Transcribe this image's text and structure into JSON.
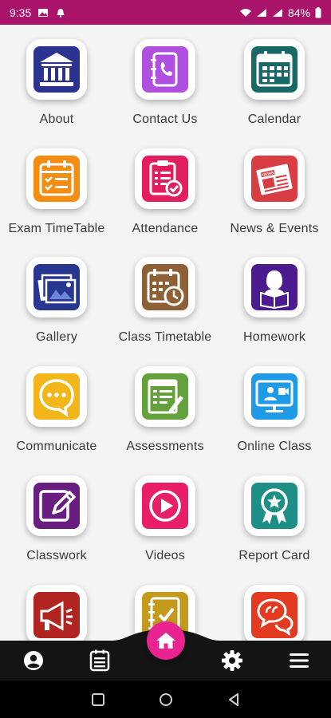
{
  "status_bar": {
    "time": "9:35",
    "battery": "84%",
    "background": "#a9136a"
  },
  "tiles": [
    {
      "label": "About",
      "icon": "bank-icon",
      "color": "#2b3290"
    },
    {
      "label": "Contact Us",
      "icon": "contact-book-icon",
      "color": "#b04fe0"
    },
    {
      "label": "Calendar",
      "icon": "calendar-icon",
      "color": "#176866"
    },
    {
      "label": "Exam TimeTable",
      "icon": "exam-calendar-icon",
      "color": "#f58d12"
    },
    {
      "label": "Attendance",
      "icon": "clipboard-check-icon",
      "color": "#e31e5f"
    },
    {
      "label": "News & Events",
      "icon": "newspaper-icon",
      "color": "#d93d44"
    },
    {
      "label": "Gallery",
      "icon": "gallery-icon",
      "color": "#27368f"
    },
    {
      "label": "Class Timetable",
      "icon": "timetable-clock-icon",
      "color": "#8f5f35"
    },
    {
      "label": "Homework",
      "icon": "reading-student-icon",
      "color": "#4b1b8f"
    },
    {
      "label": "Communicate",
      "icon": "chat-bubble-icon",
      "color": "#f3b61a"
    },
    {
      "label": "Assessments",
      "icon": "assessment-sheet-icon",
      "color": "#65a13a"
    },
    {
      "label": "Online Class",
      "icon": "online-class-icon",
      "color": "#1e9ae6"
    },
    {
      "label": "Classwork",
      "icon": "edit-square-icon",
      "color": "#6a1d80"
    },
    {
      "label": "Videos",
      "icon": "play-video-icon",
      "color": "#e81f67"
    },
    {
      "label": "Report Card",
      "icon": "award-ribbon-icon",
      "color": "#1d8f84"
    },
    {
      "label": "",
      "icon": "megaphone-icon",
      "color": "#b1241f"
    },
    {
      "label": "",
      "icon": "notebook-check-icon",
      "color": "#c49a1d"
    },
    {
      "label": "",
      "icon": "speech-bubbles-icon",
      "color": "#e23b22"
    }
  ],
  "bottom_nav": {
    "items": [
      "profile-icon",
      "schedule-icon",
      "home-icon",
      "settings-icon",
      "menu-icon"
    ],
    "accent": "#e9238f"
  }
}
